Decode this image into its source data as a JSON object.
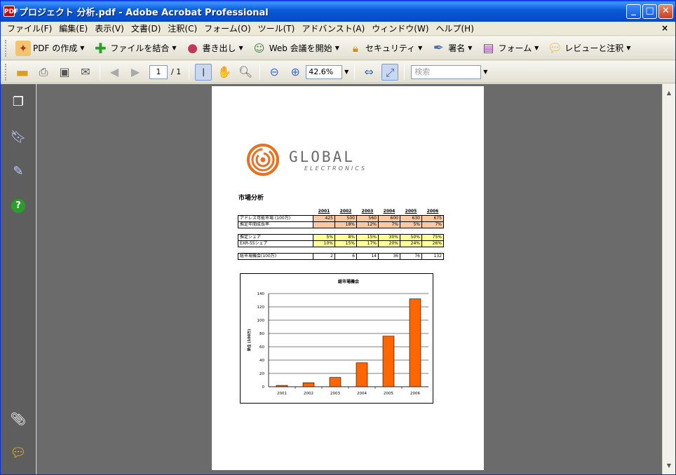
{
  "window": {
    "title": "プロジェクト 分析.pdf - Adobe Acrobat Professional",
    "icon": "pdf-icon"
  },
  "menu": [
    "ファイル(F)",
    "編集(E)",
    "表示(V)",
    "文書(D)",
    "注釈(C)",
    "フォーム(O)",
    "ツール(T)",
    "アドバンスト(A)",
    "ウィンドウ(W)",
    "ヘルプ(H)"
  ],
  "menu_close": "×",
  "toolbar1": {
    "create_pdf": "PDF の作成",
    "combine": "ファイルを結合",
    "export": "書き出し",
    "web_meeting": "Web 会議を開始",
    "security": "セキュリティ",
    "sign": "署名",
    "forms": "フォーム",
    "review": "レビューと注釈"
  },
  "toolbar2": {
    "page_current": "1",
    "page_total": "/ 1",
    "zoom": "42.6%",
    "search_placeholder": "検索"
  },
  "document": {
    "logo_title": "GLOBAL",
    "logo_sub": "ELECTRONICS",
    "heading": "市場分析",
    "years": [
      "2001",
      "2002",
      "2003",
      "2004",
      "2005",
      "2006"
    ],
    "rows": [
      {
        "label": "アドレス可能市場 (100万)",
        "values": [
          "425",
          "500",
          "560",
          "600",
          "630",
          "675"
        ],
        "style": "orange"
      },
      {
        "label": "推定年間成長率",
        "values": [
          "",
          "18%",
          "12%",
          "7%",
          "5%",
          "7%"
        ],
        "style": "orange"
      },
      {
        "label": "推定シェア",
        "values": [
          "5%",
          "8%",
          "15%",
          "30%",
          "50%",
          "75%"
        ],
        "style": "yellow"
      },
      {
        "label": "EXR-55シェア",
        "values": [
          "10%",
          "15%",
          "17%",
          "20%",
          "24%",
          "26%"
        ],
        "style": "yellow"
      },
      {
        "label": "総市場機会(100万)",
        "values": [
          "2",
          "6",
          "14",
          "36",
          "76",
          "132"
        ],
        "style": "plain"
      }
    ]
  },
  "chart_data": {
    "type": "bar",
    "title": "総市場機会",
    "ylabel": "単位 (100万)",
    "xlabel": "",
    "categories": [
      "2001",
      "2002",
      "2003",
      "2004",
      "2005",
      "2006"
    ],
    "values": [
      2,
      6,
      14,
      36,
      76,
      132
    ],
    "ylim": [
      0,
      140
    ],
    "yticks": [
      0,
      20,
      40,
      60,
      80,
      100,
      120,
      140
    ],
    "bar_color": "#ff6600",
    "grid": true
  }
}
